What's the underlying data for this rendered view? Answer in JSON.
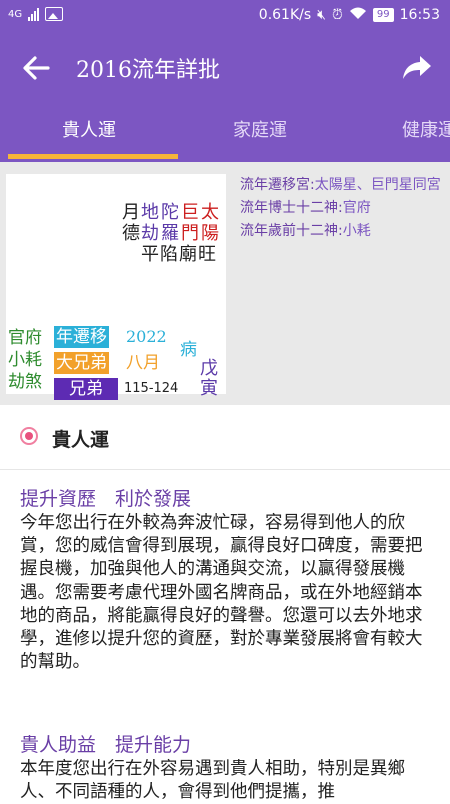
{
  "statusbar": {
    "network": "4G",
    "speed": "0.61K/s",
    "battery": "99",
    "time": "16:53"
  },
  "appbar": {
    "back_icon": "arrow-left-icon",
    "title": "2016流年詳批",
    "share_icon": "share-arrow-icon"
  },
  "tabs": [
    "貴人運",
    "家庭運",
    "健康運"
  ],
  "palace_chart": {
    "stars_top": [
      "月",
      "德",
      "地",
      "劫",
      "陀",
      "羅",
      "巨",
      "門",
      "太",
      "陽"
    ],
    "status_row": "平陷廟旺",
    "year_move": "年遷移",
    "year_move_year": "2022",
    "ill": "病",
    "big_brothers": "大兄弟",
    "eighth_month": "八月",
    "palace_name": "兄弟",
    "age_range": "115-124",
    "left_col1": "官府",
    "left_col2": "小耗",
    "left_col3": "劫煞",
    "branch": "戊寅",
    "colors": {
      "red": "#cc1f1f",
      "purple": "#5b3aa8",
      "cyan": "#2bb0d8",
      "orange": "#f2a12b",
      "deep_purple": "#5d2bb3",
      "green": "#2e8b2e"
    }
  },
  "info": {
    "line1_key": "流年遷移宮:",
    "line1_val": "太陽星、巨門星同宮",
    "line2_key": "流年博士十二神:",
    "line2_val": "官府",
    "line3_key": "流年歲前十二神:",
    "line3_val": "小耗"
  },
  "section": {
    "title": "貴人運"
  },
  "articles": [
    {
      "heading": "提升資歷　利於發展",
      "body": "今年您出行在外較為奔波忙碌，容易得到他人的欣賞，您的威信會得到展現，贏得良好口碑度，需要把握良機，加強與他人的溝通與交流，以贏得發展機遇。您需要考慮代理外國名牌商品，或在外地經銷本地的商品，將能贏得良好的聲譽。您還可以去外地求學，進修以提升您的資歷，對於專業發展將會有較大的幫助。"
    },
    {
      "heading": "貴人助益　提升能力",
      "body": "本年度您出行在外容易遇到貴人相助，特別是異鄉人、不同語種的人，會得到他們提攜，推"
    }
  ]
}
